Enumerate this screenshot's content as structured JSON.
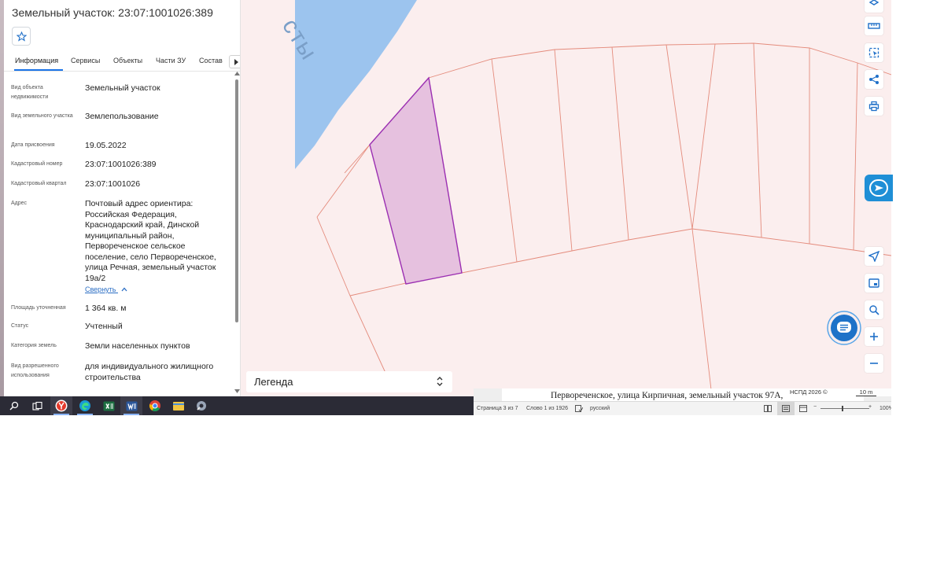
{
  "panel": {
    "title": "Земельный участок: 23:07:1001026:389",
    "tabs": [
      "Информация",
      "Сервисы",
      "Объекты",
      "Части ЗУ",
      "Состав"
    ],
    "rows": [
      {
        "label": "Вид объекта недвижимости",
        "value": "Земельный участок"
      },
      {
        "label": "Вид земельного участка",
        "value": "Землепользование"
      },
      {
        "label": "Дата присвоения",
        "value": "19.05.2022"
      },
      {
        "label": "Кадастровый номер",
        "value": "23:07:1001026:389"
      },
      {
        "label": "Кадастровый квартал",
        "value": "23:07:1001026"
      },
      {
        "label": "Адрес",
        "value": "Почтовый адрес ориентира: Российская Федерация, Краснодарский край, Динской муниципальный район, Первореченское сельское поселение, село Первореченское, улица Речная, земельный участок 19а/2"
      },
      {
        "label": "Площадь уточненная",
        "value": "1 364 кв. м"
      },
      {
        "label": "Статус",
        "value": "Учтенный"
      },
      {
        "label": "Категория земель",
        "value": "Земли населенных пунктов"
      },
      {
        "label": "Вид разрешенного использования",
        "value": "для индивидуального жилищного строительства"
      }
    ],
    "collapse_label": "Свернуть"
  },
  "map": {
    "water_label": "сты",
    "legend_label": "Легенда",
    "attribution": "НСПД 2026 ©",
    "scale_label": "10 m",
    "colors": {
      "water": "#9cc4ee",
      "parcel_fill": "#fbeeee",
      "parcel_line": "#e48b7c",
      "selected_fill": "#e6c1df",
      "selected_line": "#9b2fb2"
    },
    "tools": [
      "layers-icon",
      "ruler-icon",
      "select-area-icon",
      "share-icon",
      "print-icon",
      "locate-icon",
      "minimap-icon",
      "search-location-icon",
      "zoom-in-icon",
      "zoom-out-icon"
    ]
  },
  "document": {
    "text": "Первореченское, улица Кирпичная, земельный участок 97А,",
    "status": {
      "page": "Страница 3 из 7",
      "words": "Слово 1 из 1926",
      "language": "русский",
      "zoom": "100%"
    }
  },
  "taskbar": {
    "apps": [
      "search-icon",
      "task-view-icon",
      "yandex-browser-icon",
      "edge-icon",
      "excel-icon",
      "word-icon",
      "chrome-icon",
      "file-explorer-icon",
      "settings-icon"
    ]
  }
}
